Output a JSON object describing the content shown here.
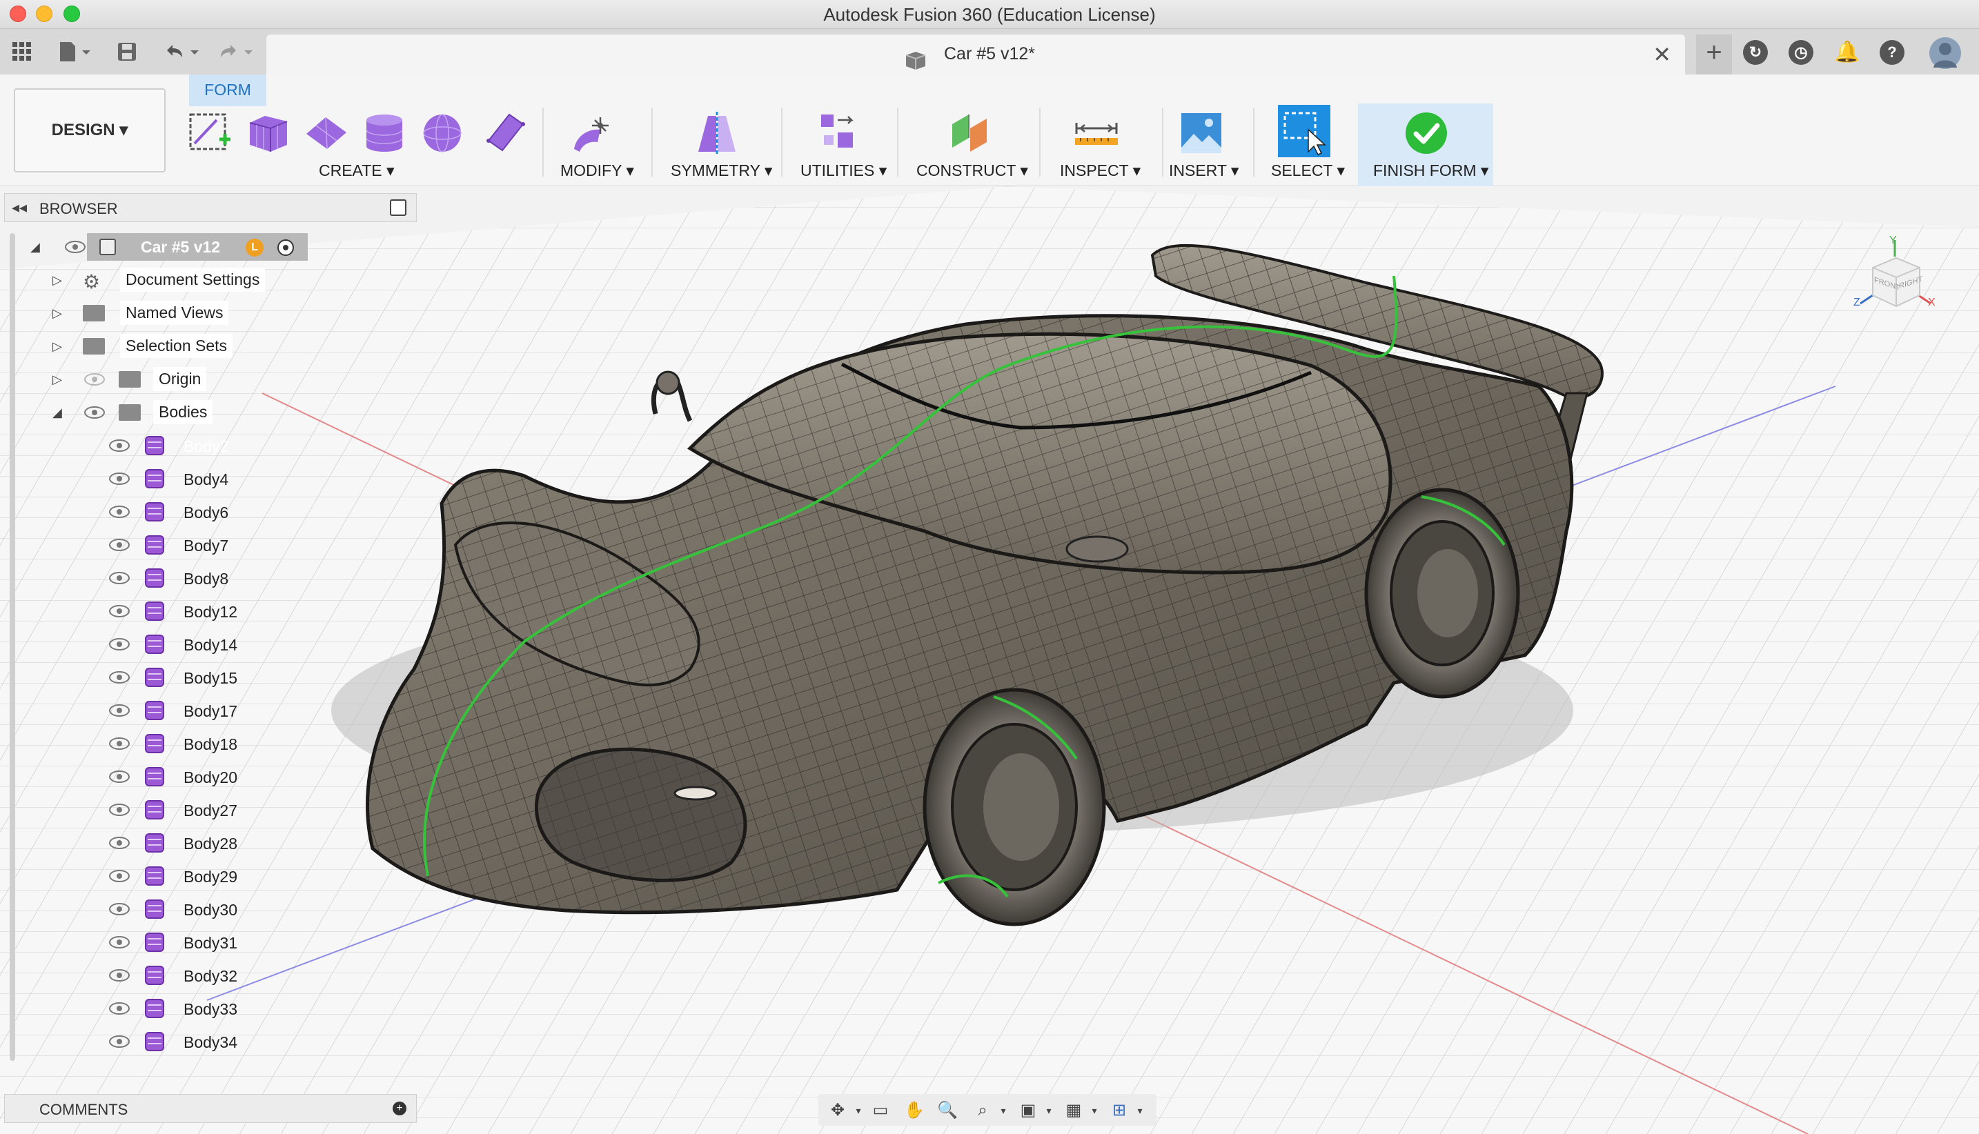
{
  "app": {
    "window_title": "Autodesk Fusion 360 (Education License)",
    "document_tab": "Car #5 v12*"
  },
  "toolbar": {
    "workspace": "DESIGN ▾",
    "active_tab": "FORM",
    "groups": [
      {
        "label": "CREATE ▾"
      },
      {
        "label": "MODIFY ▾"
      },
      {
        "label": "SYMMETRY ▾"
      },
      {
        "label": "UTILITIES ▾"
      },
      {
        "label": "CONSTRUCT ▾"
      },
      {
        "label": "INSPECT ▾"
      },
      {
        "label": "INSERT ▾"
      },
      {
        "label": "SELECT ▾"
      },
      {
        "label": "FINISH FORM ▾"
      }
    ]
  },
  "browser": {
    "title": "BROWSER",
    "root": "Car #5 v12",
    "items": [
      {
        "label": "Document Settings"
      },
      {
        "label": "Named Views"
      },
      {
        "label": "Selection Sets"
      },
      {
        "label": "Origin"
      },
      {
        "label": "Bodies"
      }
    ],
    "bodies": [
      "Body2",
      "Body4",
      "Body6",
      "Body7",
      "Body8",
      "Body12",
      "Body14",
      "Body15",
      "Body17",
      "Body18",
      "Body20",
      "Body27",
      "Body28",
      "Body29",
      "Body30",
      "Body31",
      "Body32",
      "Body33",
      "Body34"
    ],
    "selected_body": "Body2"
  },
  "comments": {
    "title": "COMMENTS"
  },
  "viewcube": {
    "top": "Y",
    "left": "Z",
    "right": "X",
    "front": "FRONT",
    "side": "RIGHT"
  },
  "colors": {
    "accent": "#1d8ee0",
    "finish_green": "#2dbb3a",
    "form_purple": "#8e5ad6"
  }
}
